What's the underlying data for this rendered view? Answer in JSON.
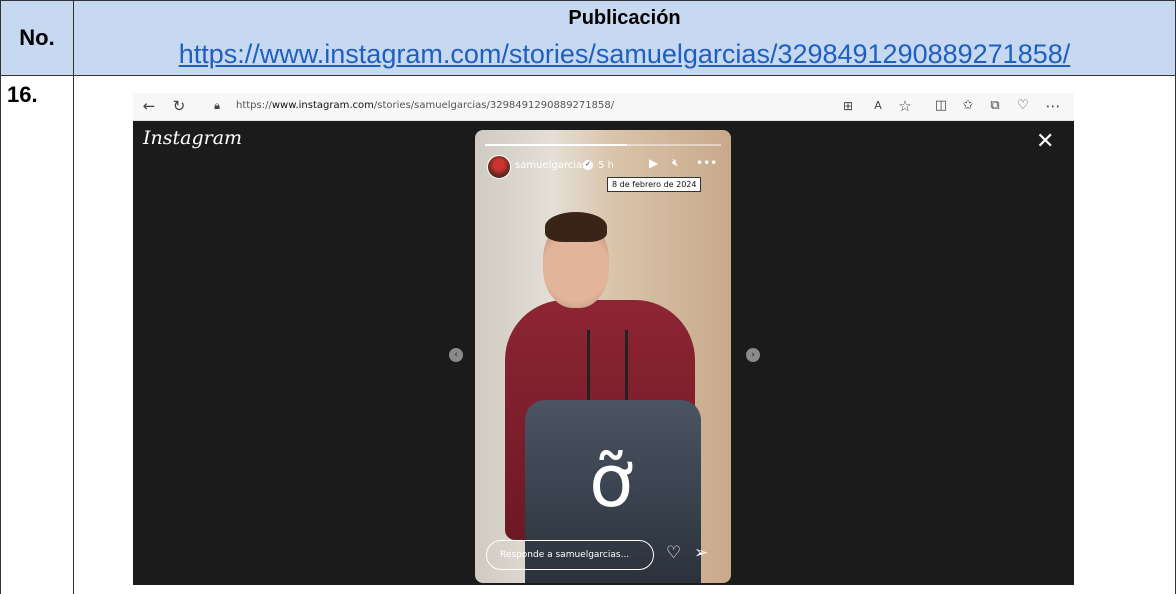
{
  "table": {
    "col_no_header": "No.",
    "col_pub_header": "Publicación",
    "link": "https://www.instagram.com/stories/samuelgarcias/3298491290889271858/",
    "row_number": "16."
  },
  "browser": {
    "url_prefix": "https://",
    "url_domain": "www.instagram.com",
    "url_path": "/stories/samuelgarcias/3298491290889271858/",
    "toolbar_icons": [
      "back-icon",
      "refresh-icon",
      "lock-icon",
      "apps-icon",
      "read-aloud-icon",
      "favorite-star-icon",
      "split-screen-icon",
      "favorites-icon",
      "collections-icon",
      "health-icon",
      "more-icon"
    ]
  },
  "instagram": {
    "logo": "Instagram",
    "story": {
      "username": "samuelgarcias",
      "time": "5 h",
      "tooltip": "8 de febrero de 2024",
      "reply_placeholder": "Responde a samuelgarcias...",
      "progress": 0.6
    }
  }
}
